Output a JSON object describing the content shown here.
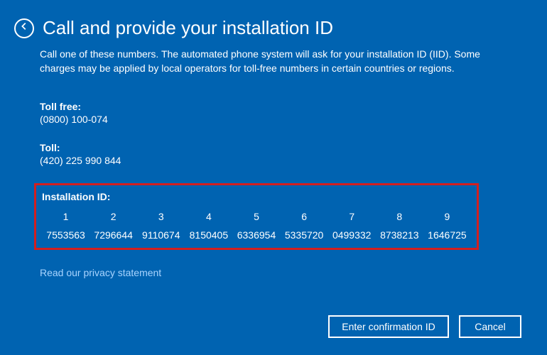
{
  "header": {
    "title": "Call and provide your installation ID"
  },
  "description": "Call one of these numbers. The automated phone system will ask for your installation ID (IID). Some charges may be applied by local operators for toll-free numbers in certain countries or regions.",
  "phones": {
    "toll_free_label": "Toll free:",
    "toll_free_number": "(0800) 100-074",
    "toll_label": "Toll:",
    "toll_number": "(420) 225 990 844"
  },
  "installation": {
    "label": "Installation ID:",
    "columns": [
      {
        "index": "1",
        "value": "7553563"
      },
      {
        "index": "2",
        "value": "7296644"
      },
      {
        "index": "3",
        "value": "9110674"
      },
      {
        "index": "4",
        "value": "8150405"
      },
      {
        "index": "5",
        "value": "6336954"
      },
      {
        "index": "6",
        "value": "5335720"
      },
      {
        "index": "7",
        "value": "0499332"
      },
      {
        "index": "8",
        "value": "8738213"
      },
      {
        "index": "9",
        "value": "1646725"
      }
    ]
  },
  "privacy_link": "Read our privacy statement",
  "buttons": {
    "enter_confirmation": "Enter confirmation ID",
    "cancel": "Cancel"
  }
}
